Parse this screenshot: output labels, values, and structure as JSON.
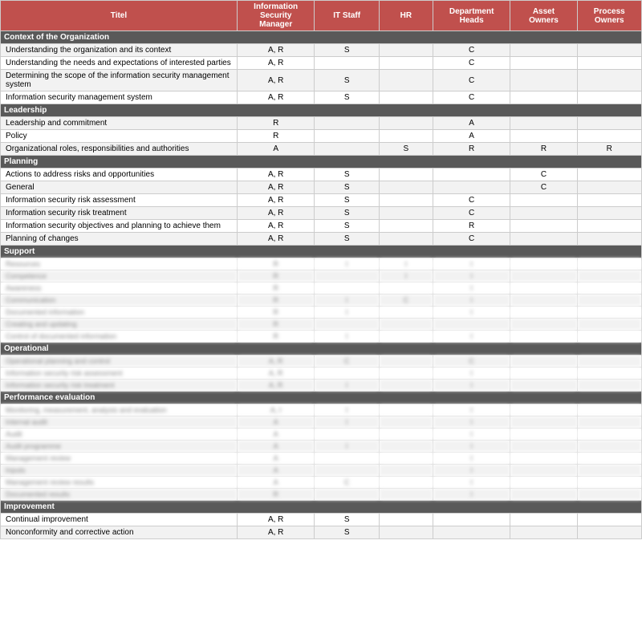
{
  "header": {
    "columns": [
      {
        "key": "title",
        "label": "Titel"
      },
      {
        "key": "ism",
        "label": "Information\nSecurity\nManager"
      },
      {
        "key": "it",
        "label": "IT Staff"
      },
      {
        "key": "hr",
        "label": "HR"
      },
      {
        "key": "dh",
        "label": "Department\nHeads"
      },
      {
        "key": "ao",
        "label": "Asset\nOwners"
      },
      {
        "key": "po",
        "label": "Process\nOwners"
      }
    ]
  },
  "sections": [
    {
      "name": "Context of the Organization",
      "rows": [
        {
          "title": "Understanding the organization and its context",
          "ism": "A, R",
          "it": "S",
          "hr": "",
          "dh": "C",
          "ao": "",
          "po": ""
        },
        {
          "title": "Understanding the needs and expectations of interested parties",
          "ism": "A, R",
          "it": "",
          "hr": "",
          "dh": "C",
          "ao": "",
          "po": ""
        },
        {
          "title": "Determining the scope of the information security management system",
          "ism": "A, R",
          "it": "S",
          "hr": "",
          "dh": "C",
          "ao": "",
          "po": ""
        },
        {
          "title": "Information security management system",
          "ism": "A, R",
          "it": "S",
          "hr": "",
          "dh": "C",
          "ao": "",
          "po": ""
        }
      ]
    },
    {
      "name": "Leadership",
      "rows": [
        {
          "title": "Leadership and commitment",
          "ism": "R",
          "it": "",
          "hr": "",
          "dh": "A",
          "ao": "",
          "po": ""
        },
        {
          "title": "Policy",
          "ism": "R",
          "it": "",
          "hr": "",
          "dh": "A",
          "ao": "",
          "po": ""
        },
        {
          "title": "Organizational roles, responsibilities and authorities",
          "ism": "A",
          "it": "",
          "hr": "S",
          "dh": "R",
          "ao": "R",
          "po": "R"
        }
      ]
    },
    {
      "name": "Planning",
      "rows": [
        {
          "title": "Actions to address risks and opportunities",
          "ism": "A, R",
          "it": "S",
          "hr": "",
          "dh": "",
          "ao": "C",
          "po": ""
        },
        {
          "title": "General",
          "ism": "A, R",
          "it": "S",
          "hr": "",
          "dh": "",
          "ao": "C",
          "po": ""
        },
        {
          "title": "Information security risk assessment",
          "ism": "A, R",
          "it": "S",
          "hr": "",
          "dh": "C",
          "ao": "",
          "po": ""
        },
        {
          "title": "Information security risk treatment",
          "ism": "A, R",
          "it": "S",
          "hr": "",
          "dh": "C",
          "ao": "",
          "po": ""
        },
        {
          "title": "Information security objectives and planning to achieve them",
          "ism": "A, R",
          "it": "S",
          "hr": "",
          "dh": "R",
          "ao": "",
          "po": ""
        },
        {
          "title": "Planning of changes",
          "ism": "A, R",
          "it": "S",
          "hr": "",
          "dh": "C",
          "ao": "",
          "po": ""
        }
      ]
    },
    {
      "name": "Support",
      "rows": [
        {
          "title": "Resources",
          "ism": "R",
          "it": "I",
          "hr": "I",
          "dh": "I",
          "ao": "",
          "po": "",
          "blurred": true
        },
        {
          "title": "Competence",
          "ism": "R",
          "it": "",
          "hr": "I",
          "dh": "I",
          "ao": "",
          "po": "",
          "blurred": true
        },
        {
          "title": "Awareness",
          "ism": "R",
          "it": "",
          "hr": "",
          "dh": "I",
          "ao": "",
          "po": "",
          "blurred": true
        },
        {
          "title": "Communication",
          "ism": "R",
          "it": "I",
          "hr": "C",
          "dh": "I",
          "ao": "",
          "po": "",
          "blurred": true
        },
        {
          "title": "Documented information",
          "ism": "R",
          "it": "I",
          "hr": "",
          "dh": "I",
          "ao": "",
          "po": "",
          "blurred": true
        },
        {
          "title": "Creating and updating",
          "ism": "R",
          "it": "",
          "hr": "",
          "dh": "",
          "ao": "",
          "po": "",
          "blurred": true
        },
        {
          "title": "Control of documented information",
          "ism": "R",
          "it": "I",
          "hr": "",
          "dh": "I",
          "ao": "",
          "po": "",
          "blurred": true
        }
      ]
    },
    {
      "name": "Operational",
      "rows": [
        {
          "title": "Operational planning and control",
          "ism": "A, R",
          "it": "C",
          "hr": "",
          "dh": "C",
          "ao": "",
          "po": "",
          "blurred": true
        },
        {
          "title": "Information security risk assessment",
          "ism": "A, R",
          "it": "",
          "hr": "",
          "dh": "I",
          "ao": "",
          "po": "",
          "blurred": true
        },
        {
          "title": "Information security risk treatment",
          "ism": "A, R",
          "it": "I",
          "hr": "",
          "dh": "I",
          "ao": "",
          "po": "",
          "blurred": true
        }
      ]
    },
    {
      "name": "Performance evaluation",
      "rows": [
        {
          "title": "Monitoring, measurement, analysis and evaluation",
          "ism": "A, I",
          "it": "I",
          "hr": "",
          "dh": "I",
          "ao": "",
          "po": "",
          "blurred": true
        },
        {
          "title": "Internal audit",
          "ism": "A",
          "it": "I",
          "hr": "",
          "dh": "I",
          "ao": "",
          "po": "",
          "blurred": true
        },
        {
          "title": "Audit",
          "ism": "A",
          "it": "",
          "hr": "",
          "dh": "I",
          "ao": "",
          "po": "",
          "blurred": true
        },
        {
          "title": "Audit programme",
          "ism": "A",
          "it": "I",
          "hr": "",
          "dh": "I",
          "ao": "",
          "po": "",
          "blurred": true
        },
        {
          "title": "Management review",
          "ism": "A",
          "it": "",
          "hr": "",
          "dh": "I",
          "ao": "",
          "po": "",
          "blurred": true
        },
        {
          "title": "Inputs",
          "ism": "A",
          "it": "",
          "hr": "",
          "dh": "I",
          "ao": "",
          "po": "",
          "blurred": true
        },
        {
          "title": "Management review results",
          "ism": "A",
          "it": "C",
          "hr": "",
          "dh": "I",
          "ao": "",
          "po": "",
          "blurred": true
        },
        {
          "title": "Documented results",
          "ism": "R",
          "it": "",
          "hr": "",
          "dh": "I",
          "ao": "",
          "po": "",
          "blurred": true
        }
      ]
    },
    {
      "name": "Improvement",
      "rows": [
        {
          "title": "Continual improvement",
          "ism": "A, R",
          "it": "S",
          "hr": "",
          "dh": "",
          "ao": "",
          "po": ""
        },
        {
          "title": "Nonconformity and corrective action",
          "ism": "A, R",
          "it": "S",
          "hr": "",
          "dh": "",
          "ao": "",
          "po": ""
        }
      ]
    }
  ]
}
